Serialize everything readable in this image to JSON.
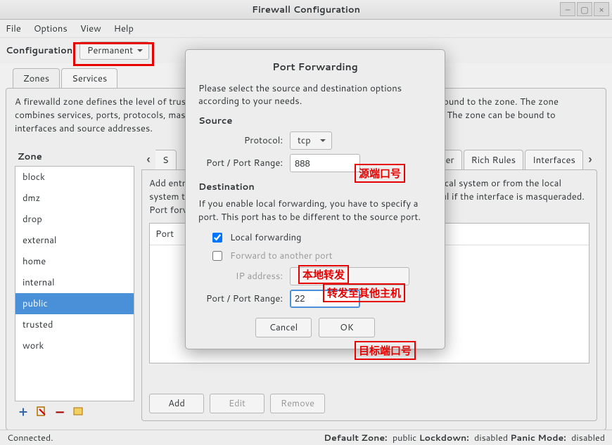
{
  "window": {
    "title": "Firewall Configuration"
  },
  "menubar": {
    "file": "File",
    "options": "Options",
    "view": "View",
    "help": "Help"
  },
  "toolbar": {
    "config_label": "Configuration:",
    "config_value": "Permanent"
  },
  "notebook": {
    "tabs": {
      "zones": "Zones",
      "services": "Services"
    },
    "zone_desc": "A firewalld zone defines the level of trust for network connections, interfaces and source addresses bound to the zone. The zone combines services, ports, protocols, masquerading, port/packet forwarding, icmp filters and rich rules. The zone can be bound to interfaces and source addresses."
  },
  "zones": {
    "header": "Zone",
    "items": [
      "block",
      "dmz",
      "drop",
      "external",
      "home",
      "internal",
      "public",
      "trusted",
      "work"
    ],
    "selected": "public"
  },
  "righttabs": {
    "t0": "S",
    "t1": "ter",
    "t2": "Rich Rules",
    "t3": "Interfaces"
  },
  "rightpanel": {
    "help": "Add entries to forward ports either from one port to another on the local system or from the local system to another system. Forwarding to another system is only useful if the interface is masqueraded. Port forwarding is IPv4 only.",
    "grid_col": "Port"
  },
  "buttons": {
    "add": "Add",
    "edit": "Edit",
    "remove": "Remove"
  },
  "dialog": {
    "title": "Port Forwarding",
    "intro": "Please select the source and destination options according to your needs.",
    "source_hdr": "Source",
    "protocol_label": "Protocol:",
    "protocol_value": "tcp",
    "src_port_label": "Port / Port Range:",
    "src_port_value": "888",
    "dest_hdr": "Destination",
    "dest_help": "If you enable local forwarding, you have to specify a port. This port has to be different to the source port.",
    "local_fwd": "Local forwarding",
    "fwd_other": "Forward to another port",
    "ip_label": "IP address:",
    "dst_port_label": "Port / Port Range:",
    "dst_port_value": "22",
    "cancel": "Cancel",
    "ok": "OK"
  },
  "annotations": {
    "ann1": "源端口号",
    "ann2": "本地转发",
    "ann3": "转发至其他主机",
    "ann4": "目标端口号"
  },
  "statusbar": {
    "left": "Connected.",
    "dz_label": "Default Zone:",
    "dz_value": "public",
    "ld_label": "Lockdown:",
    "ld_value": "disabled",
    "pm_label": "Panic Mode:",
    "pm_value": "disabled"
  }
}
